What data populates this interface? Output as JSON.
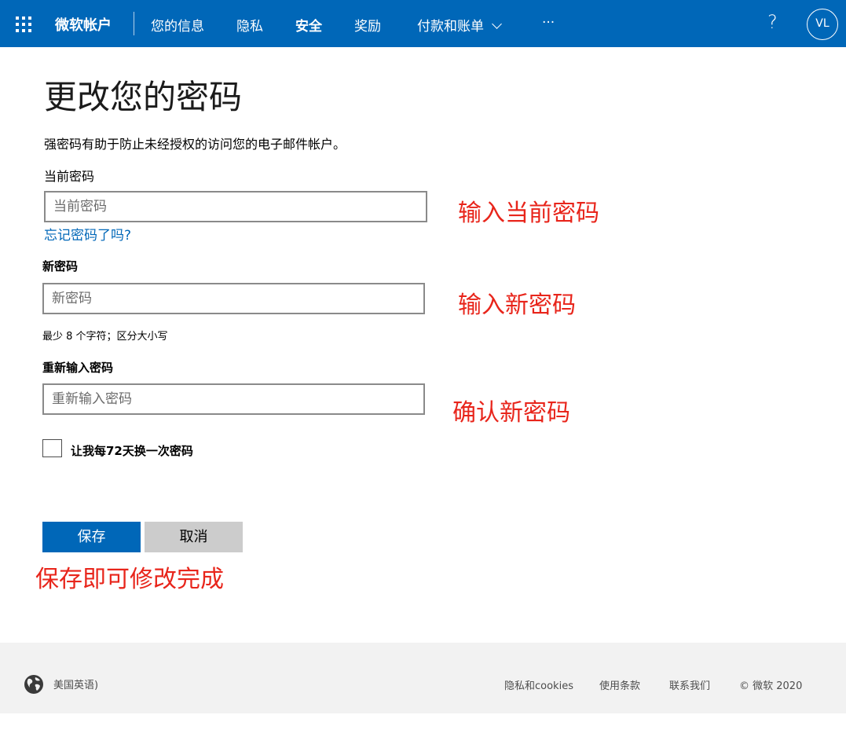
{
  "header": {
    "brand": "微软帐户",
    "nav": [
      "您的信息",
      "隐私",
      "安全",
      "奖励",
      "付款和账单",
      "···"
    ],
    "active_nav": "安全",
    "help": "?",
    "avatar_initials": "VL",
    "brand_color": "#0067b8"
  },
  "main": {
    "title": "更改您的密码",
    "description": "强密码有助于防止未经授权的访问您的电子邮件帐户。",
    "current_password": {
      "label": "当前密码",
      "placeholder": "当前密码"
    },
    "forgot_link": "忘记密码了吗?",
    "new_password": {
      "label": "新密码",
      "placeholder": "新密码",
      "hint": "最少 8 个字符；区分大小写"
    },
    "reenter_password": {
      "label": "重新输入密码",
      "placeholder": "重新输入密码"
    },
    "checkbox": {
      "label": "让我每72天换一次密码",
      "checked": false
    },
    "save_label": "保存",
    "cancel_label": "取消"
  },
  "annotations": {
    "current": "输入当前密码",
    "new": "输入新密码",
    "confirm": "确认新密码",
    "save": "保存即可修改完成",
    "color": "#e8251b"
  },
  "footer": {
    "locale": "美国英语)",
    "links": [
      "隐私和cookies",
      "使用条款",
      "联系我们"
    ],
    "copyright": "© 微软 2020"
  }
}
